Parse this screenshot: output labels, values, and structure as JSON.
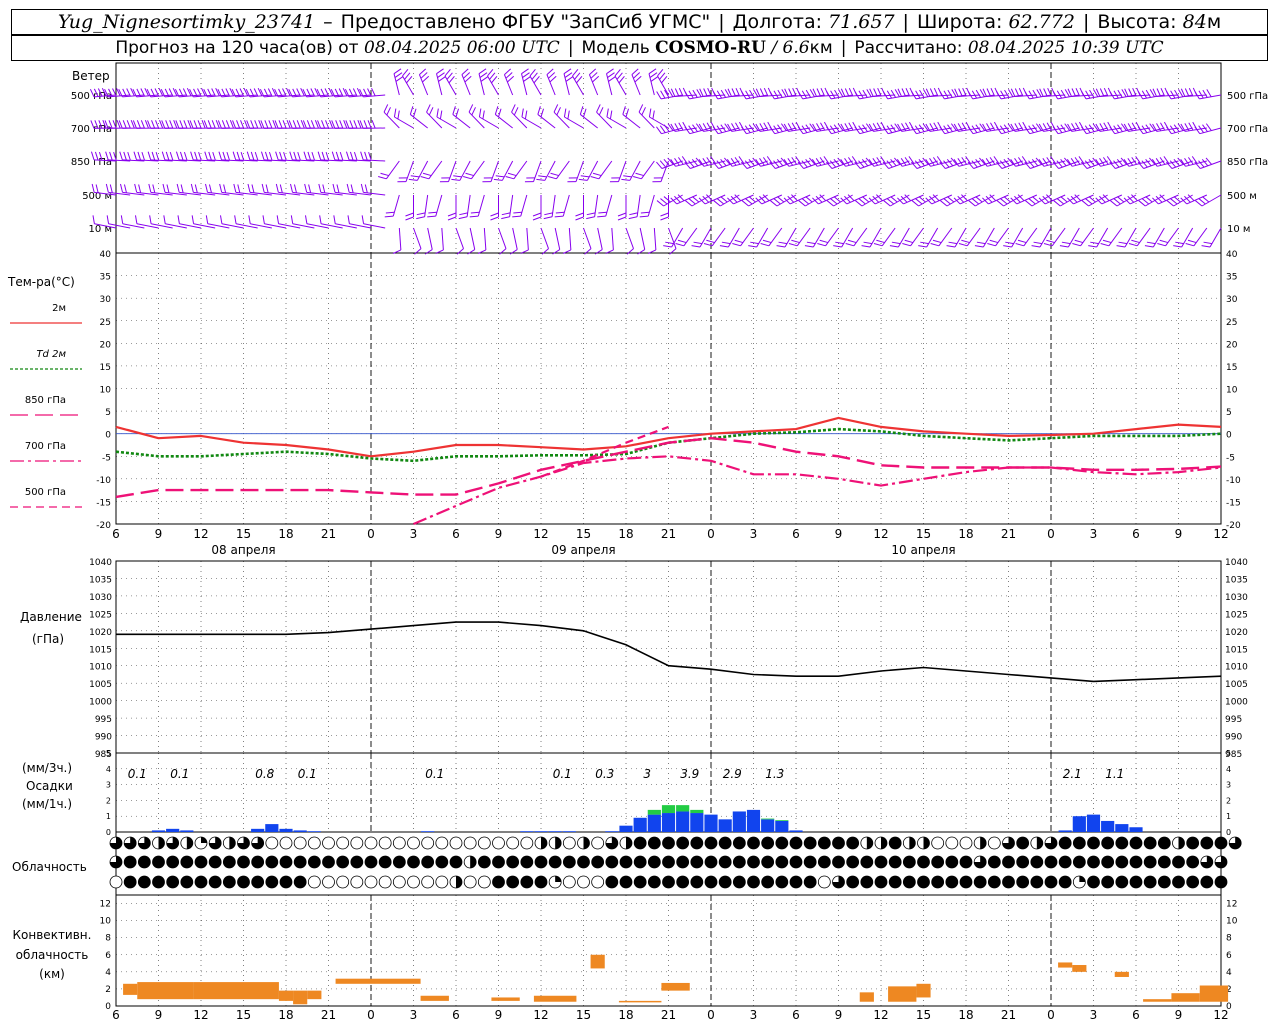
{
  "header": {
    "line1": {
      "station": "Yug_Nignesortimky_23741",
      "dash": "–",
      "provider": "Предоставлено ФГБУ \"ЗапСиб УГМС\"",
      "lon_label": "Долгота:",
      "lon_value": "71.657",
      "lat_label": "Широта:",
      "lat_value": "62.772",
      "alt_label": "Высота:",
      "alt_value": "84",
      "alt_unit": "м"
    },
    "line2": {
      "forecast_label": "Прогноз на 120 часа(ов) от",
      "forecast_time": "08.04.2025 06:00 UTC",
      "model_label": "Модель",
      "model_name": "COSMO-RU",
      "model_sep": "/",
      "model_res": "6.6",
      "model_res_unit": "км",
      "calc_label": "Рассчитано:",
      "calc_time": "08.04.2025 10:39 UTC"
    }
  },
  "colors": {
    "t2m": "#ee3333",
    "td2m": "#118811",
    "t850": "#ee1177",
    "t700": "#ee1177",
    "t500": "#ee1177",
    "wind": "#8800ee",
    "pressure": "#000000",
    "precip": "#1144ee",
    "snow": "#22cc44",
    "convective": "#ee8822",
    "grid": "#000000"
  },
  "chart_data": [
    {
      "type": "wind_barbs",
      "title": "Ветер",
      "levels": [
        "500 гПа",
        "700 гПа",
        "850 гПа",
        "500 м",
        "10 м"
      ],
      "grid": true,
      "note": "barb directions and speeds shown per time step; schematic"
    },
    {
      "type": "line",
      "ylabel": "Тем-ра(°C)",
      "ylim": [
        -20,
        40
      ],
      "yticks": [
        -20,
        -15,
        -10,
        -5,
        0,
        5,
        10,
        15,
        20,
        25,
        30,
        35,
        40
      ],
      "x_hours": [
        0,
        3,
        6,
        9,
        12,
        15,
        18,
        21,
        24,
        27,
        30,
        33,
        36,
        39,
        42,
        45,
        48,
        51,
        54,
        57,
        60,
        63,
        66,
        69,
        72,
        75,
        78
      ],
      "x_tick_labels": [
        "6",
        "9",
        "12",
        "15",
        "18",
        "21",
        "0",
        "3",
        "6",
        "9",
        "12",
        "15",
        "18",
        "21",
        "0",
        "3",
        "6",
        "9",
        "12",
        "15",
        "18",
        "21",
        "0",
        "3",
        "6",
        "9",
        "12"
      ],
      "date_labels": [
        "08 апреля",
        "09 апреля",
        "10 апреля"
      ],
      "grid": true,
      "series": [
        {
          "name": "2м",
          "style": "solid",
          "values": [
            1.5,
            -1,
            -0.5,
            -2,
            -2.5,
            -3.5,
            -5,
            -4,
            -2.5,
            -2.5,
            -3,
            -3.5,
            -2.8,
            -1,
            0,
            0.5,
            1,
            3.5,
            1.5,
            0.5,
            0,
            -0.5,
            -0.3,
            0,
            1,
            2,
            1.5
          ]
        },
        {
          "name": "Td 2м",
          "style": "dotted",
          "values": [
            -4,
            -5,
            -5,
            -4.5,
            -4,
            -4.5,
            -5.5,
            -6,
            -5,
            -5,
            -4.8,
            -4.8,
            -4.5,
            -2,
            -1,
            0,
            0.3,
            1,
            0.5,
            -0.5,
            -1,
            -1.5,
            -1,
            -0.5,
            -0.5,
            -0.5,
            0
          ]
        },
        {
          "name": "850 гПа",
          "style": "dash-long",
          "values": [
            -14,
            -12.5,
            -12.5,
            -12.5,
            -12.5,
            -12.5,
            -13,
            -13.5,
            -13.5,
            -11,
            -8,
            -6,
            -4,
            -2,
            -1,
            -2,
            -4,
            -5,
            -7,
            -7.5,
            -7.5,
            -7.5,
            -7.5,
            -8,
            -8,
            -7.8,
            -7.3
          ]
        },
        {
          "name": "700 гПа",
          "style": "dash-dot",
          "values": [
            null,
            null,
            null,
            null,
            null,
            null,
            null,
            -20,
            -16,
            -12,
            -9.5,
            -6.5,
            -5.5,
            -5,
            -6,
            -9,
            -9,
            -10,
            -11.5,
            -10,
            -8.5,
            -7.5,
            -7.5,
            -8.5,
            -9,
            -8.5,
            -7.5
          ]
        },
        {
          "name": "500 гПа",
          "style": "dash-short",
          "values": [
            null,
            null,
            null,
            null,
            null,
            null,
            null,
            null,
            null,
            null,
            -9.5,
            -6,
            -2,
            1.5,
            null,
            null,
            null,
            null,
            null,
            null,
            null,
            null,
            null,
            null,
            null,
            null,
            null
          ]
        }
      ]
    },
    {
      "type": "line",
      "ylabel": "Давление",
      "yunit": "(гПа)",
      "ylim": [
        985,
        1040
      ],
      "yticks": [
        985,
        990,
        995,
        1000,
        1005,
        1010,
        1015,
        1020,
        1025,
        1030,
        1035,
        1040
      ],
      "x_hours": [
        0,
        3,
        6,
        9,
        12,
        15,
        18,
        21,
        24,
        27,
        30,
        33,
        36,
        39,
        42,
        45,
        48,
        51,
        54,
        57,
        60,
        63,
        66,
        69,
        72,
        75,
        78
      ],
      "series": [
        {
          "name": "",
          "values": [
            1019,
            1019,
            1019,
            1019,
            1019,
            1019.5,
            1020.5,
            1021.5,
            1022.5,
            1022.5,
            1021.5,
            1020,
            1016,
            1010,
            1009,
            1007.5,
            1007,
            1007,
            1008.5,
            1009.5,
            1008.5,
            1007.5,
            1006.5,
            1005.5,
            1006,
            1006.5,
            1007
          ]
        }
      ],
      "grid": true
    },
    {
      "type": "bar",
      "ylabel": "(мм/3ч.)",
      "title": "Осадки",
      "yunit": "(мм/1ч.)",
      "ylim": [
        0,
        5
      ],
      "yticks": [
        0,
        1,
        2,
        3,
        4,
        5
      ],
      "labels_3h": [
        {
          "h": 1.5,
          "v": "0.1"
        },
        {
          "h": 4.5,
          "v": "0.1"
        },
        {
          "h": 10.5,
          "v": "0.8"
        },
        {
          "h": 13.5,
          "v": "0.1"
        },
        {
          "h": 22.5,
          "v": "0.1"
        },
        {
          "h": 31.5,
          "v": "0.1"
        },
        {
          "h": 34.5,
          "v": "0.3"
        },
        {
          "h": 37.5,
          "v": "3"
        },
        {
          "h": 40.5,
          "v": "3.9"
        },
        {
          "h": 43.5,
          "v": "2.9"
        },
        {
          "h": 46.5,
          "v": "1.3"
        },
        {
          "h": 67.5,
          "v": "2.1"
        },
        {
          "h": 70.5,
          "v": "1.1"
        }
      ],
      "hourly_rain": [
        0,
        0,
        0,
        0.1,
        0.2,
        0.1,
        0,
        0,
        0,
        0,
        0.2,
        0.5,
        0.2,
        0.1,
        0.05,
        0,
        0,
        0,
        0,
        0,
        0,
        0,
        0.05,
        0,
        0,
        0,
        0,
        0,
        0,
        0.05,
        0.05,
        0.05,
        0.05,
        0,
        0,
        0.05,
        0.4,
        0.9,
        1.1,
        1.2,
        1.3,
        1.2,
        1.1,
        0.8,
        1.3,
        1.4,
        0.8,
        0.7,
        0.1,
        0,
        0,
        0,
        0,
        0,
        0,
        0,
        0,
        0,
        0,
        0,
        0,
        0,
        0,
        0,
        0,
        0,
        0,
        0.1,
        1,
        1.1,
        0.7,
        0.5,
        0.3,
        0,
        0,
        0,
        0,
        0,
        0
      ],
      "hourly_snow": [
        0,
        0,
        0,
        0,
        0,
        0,
        0,
        0,
        0,
        0,
        0,
        0,
        0,
        0,
        0,
        0,
        0,
        0,
        0,
        0,
        0,
        0,
        0,
        0,
        0,
        0,
        0,
        0,
        0,
        0,
        0,
        0,
        0,
        0,
        0,
        0,
        0,
        0,
        0.3,
        0.5,
        0.4,
        0.2,
        0,
        0,
        0,
        0,
        0.05,
        0.05,
        0,
        0,
        0,
        0,
        0,
        0,
        0,
        0,
        0,
        0,
        0,
        0,
        0,
        0,
        0,
        0,
        0,
        0,
        0,
        0,
        0,
        0,
        0,
        0,
        0,
        0,
        0,
        0,
        0,
        0,
        0
      ]
    },
    {
      "type": "heatmap",
      "ylabel": "Облачность",
      "rows": 3,
      "cloud_fraction_row_high": [
        0.75,
        0.75,
        0.75,
        0.5,
        0.75,
        0.5,
        0.25,
        0.75,
        0.5,
        0.75,
        0.75,
        0,
        0,
        0,
        0,
        0,
        0,
        0,
        0,
        0,
        0,
        0,
        0,
        0,
        0,
        0,
        0,
        0,
        0,
        0,
        0.5,
        0.5,
        0,
        0.5,
        0,
        0.75,
        0.5,
        1,
        1,
        1,
        1,
        1,
        1,
        1,
        1,
        1,
        1,
        1,
        1,
        1,
        1,
        1,
        1,
        0.5,
        0.5,
        1,
        0.5,
        0.5,
        0,
        0,
        0,
        0.5,
        0,
        0.75,
        1,
        0.5,
        0.75,
        1,
        1,
        1,
        1,
        1,
        1,
        1,
        1,
        0.5,
        1,
        1,
        1,
        0.75
      ],
      "cloud_fraction_row_mid": [
        0.75,
        1,
        1,
        1,
        1,
        1,
        1,
        1,
        1,
        1,
        1,
        1,
        1,
        1,
        1,
        1,
        1,
        1,
        1,
        1,
        1,
        1,
        1,
        1,
        1,
        0.5,
        1,
        1,
        1,
        1,
        1,
        1,
        1,
        1,
        1,
        1,
        1,
        1,
        1,
        1,
        1,
        1,
        1,
        1,
        1,
        1,
        1,
        1,
        1,
        1,
        1,
        1,
        1,
        1,
        1,
        1,
        1,
        1,
        1,
        1,
        1,
        0.75,
        1,
        1,
        1,
        1,
        1,
        1,
        1,
        1,
        1,
        1,
        1,
        1,
        1,
        1,
        1,
        0.75,
        0.75
      ],
      "cloud_fraction_row_low": [
        0,
        1,
        1,
        1,
        1,
        1,
        1,
        1,
        1,
        1,
        1,
        1,
        1,
        1,
        0,
        0,
        0,
        0,
        0,
        0,
        0,
        0,
        0,
        0,
        0.5,
        0,
        0,
        1,
        1,
        1,
        1,
        0.25,
        0,
        0,
        0,
        1,
        1,
        1,
        1,
        1,
        1,
        1,
        1,
        1,
        1,
        1,
        1,
        1,
        1,
        1,
        0,
        0.75,
        1,
        1,
        1,
        1,
        1,
        1,
        1,
        1,
        1,
        1,
        1,
        1,
        1,
        1,
        1,
        1,
        0.25,
        1,
        1,
        1,
        1,
        1,
        1,
        1,
        1,
        1,
        1
      ]
    },
    {
      "type": "bar",
      "ylabel": "Конвективн. облачность (км)",
      "ylabel_lines": [
        "Конвективн.",
        "облачность",
        "(км)"
      ],
      "ylim": [
        0,
        13
      ],
      "yticks": [
        0,
        2,
        4,
        6,
        8,
        10,
        12
      ],
      "x_tick_labels": [
        "6",
        "9",
        "12",
        "15",
        "18",
        "21",
        "0",
        "3",
        "6",
        "9",
        "12",
        "15",
        "18",
        "21",
        "0",
        "3",
        "6",
        "9",
        "12",
        "15",
        "18",
        "21",
        "0",
        "3",
        "6",
        "9",
        "12"
      ],
      "layers": [
        {
          "h0": 0.5,
          "h1": 1.5,
          "base": 1.3,
          "top": 2.6
        },
        {
          "h0": 1.5,
          "h1": 5.5,
          "base": 0.8,
          "top": 2.8
        },
        {
          "h0": 5.5,
          "h1": 11.5,
          "base": 0.8,
          "top": 2.8
        },
        {
          "h0": 11.5,
          "h1": 12.5,
          "base": 0.6,
          "top": 1.8
        },
        {
          "h0": 12.5,
          "h1": 13.5,
          "base": 0.2,
          "top": 1.8
        },
        {
          "h0": 13.5,
          "h1": 14.5,
          "base": 0.8,
          "top": 1.8
        },
        {
          "h0": 15.5,
          "h1": 21.5,
          "base": 2.6,
          "top": 3.2
        },
        {
          "h0": 21.5,
          "h1": 23.5,
          "base": 0.6,
          "top": 1.2
        },
        {
          "h0": 26.5,
          "h1": 28.5,
          "base": 0.6,
          "top": 1.0
        },
        {
          "h0": 29.5,
          "h1": 32.5,
          "base": 0.5,
          "top": 1.2
        },
        {
          "h0": 33.5,
          "h1": 34.5,
          "base": 4.4,
          "top": 6.0
        },
        {
          "h0": 35.5,
          "h1": 38.5,
          "base": 0.5,
          "top": 0.6
        },
        {
          "h0": 38.5,
          "h1": 40.5,
          "base": 1.8,
          "top": 2.7
        },
        {
          "h0": 52.5,
          "h1": 53.5,
          "base": 0.5,
          "top": 1.6
        },
        {
          "h0": 54.5,
          "h1": 56.5,
          "base": 0.5,
          "top": 2.3
        },
        {
          "h0": 56.5,
          "h1": 57.5,
          "base": 1.0,
          "top": 2.6
        },
        {
          "h0": 66.5,
          "h1": 67.5,
          "base": 4.5,
          "top": 5.1
        },
        {
          "h0": 67.5,
          "h1": 68.5,
          "base": 4.0,
          "top": 4.8
        },
        {
          "h0": 70.5,
          "h1": 71.5,
          "base": 3.4,
          "top": 4.0
        },
        {
          "h0": 72.5,
          "h1": 74.5,
          "base": 0.5,
          "top": 0.8
        },
        {
          "h0": 74.5,
          "h1": 76.5,
          "base": 0.5,
          "top": 1.5
        },
        {
          "h0": 76.5,
          "h1": 78.5,
          "base": 0.5,
          "top": 2.4
        }
      ],
      "grid": true
    }
  ]
}
